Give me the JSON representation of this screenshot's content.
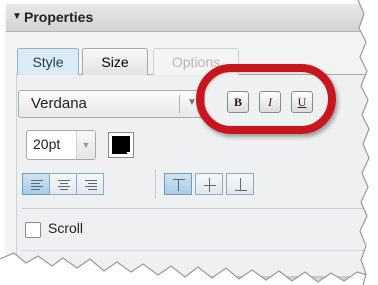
{
  "panel": {
    "title": "Properties"
  },
  "tabs": [
    {
      "label": "Style",
      "state": "active"
    },
    {
      "label": "Size",
      "state": "normal"
    },
    {
      "label": "Options",
      "state": "disabled"
    }
  ],
  "font": {
    "family": "Verdana",
    "size": "20pt",
    "color": "#000000"
  },
  "text_style_buttons": {
    "bold": "B",
    "italic": "I",
    "underline": "U"
  },
  "alignment": {
    "horizontal": [
      "align-left",
      "align-center",
      "align-right"
    ],
    "horizontal_selected": "align-left",
    "vertical": [
      "align-top",
      "align-middle",
      "align-bottom"
    ],
    "vertical_selected": "align-top"
  },
  "scroll": {
    "label": "Scroll",
    "checked": false
  },
  "annotation": {
    "highlight_color": "#c8161d"
  }
}
